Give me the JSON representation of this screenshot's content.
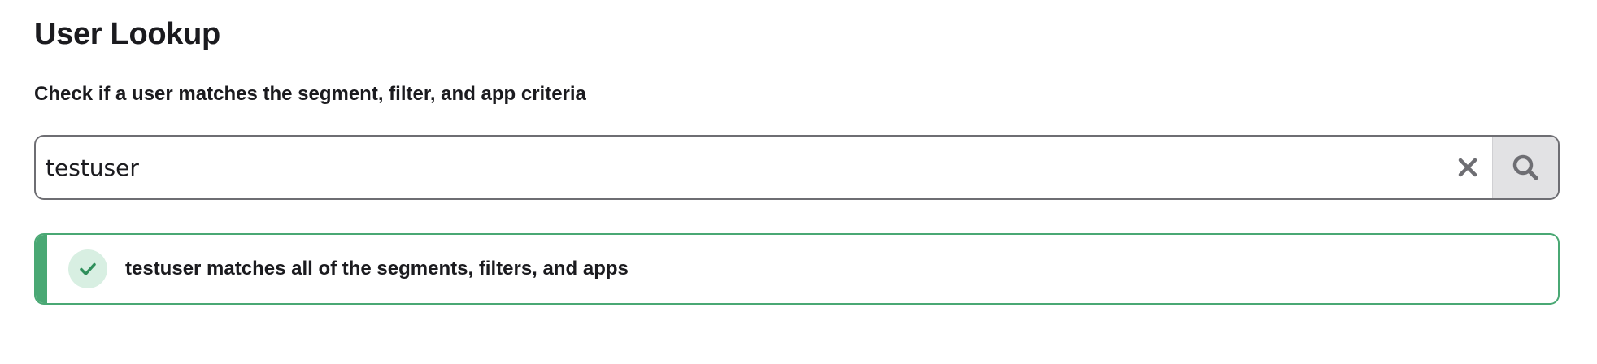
{
  "page": {
    "title": "User Lookup",
    "subtitle": "Check if a user matches the segment, filter, and app criteria"
  },
  "search": {
    "value": "testuser",
    "clear_icon": "close-icon",
    "search_icon": "search-icon"
  },
  "result": {
    "status": "success",
    "icon": "check-icon",
    "message": "testuser matches all of the segments, filters, and apps"
  },
  "colors": {
    "success_accent": "#4aa874",
    "success_icon_bg": "#d8efe2",
    "search_button_bg": "#e2e2e4",
    "text": "#1b1b1f"
  }
}
